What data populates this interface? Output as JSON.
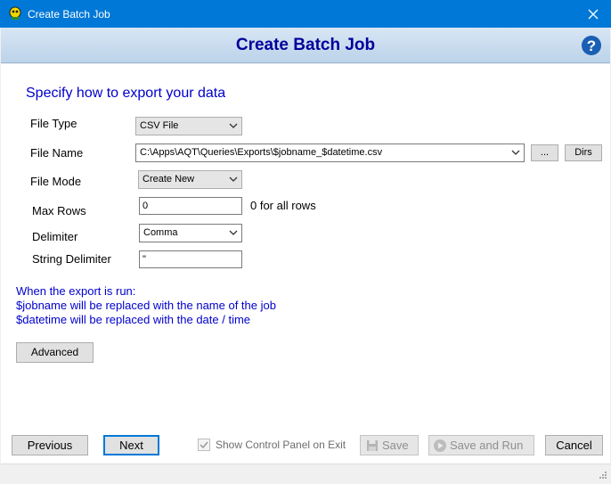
{
  "window": {
    "title": "Create Batch Job",
    "close_glyph": "✕"
  },
  "header": {
    "title": "Create Batch Job",
    "help_glyph": "?"
  },
  "section": {
    "heading": "Specify how to export your data"
  },
  "form": {
    "file_type": {
      "label": "File Type",
      "value": "CSV File"
    },
    "file_name": {
      "label": "File Name",
      "value": "C:\\Apps\\AQT\\Queries\\Exports\\$jobname_$datetime.csv",
      "browse_label": "...",
      "dirs_label": "Dirs"
    },
    "file_mode": {
      "label": "File Mode",
      "value": "Create New"
    },
    "max_rows": {
      "label": "Max Rows",
      "value": "0",
      "hint": "0 for all rows"
    },
    "delimiter": {
      "label": "Delimiter",
      "value": "Comma"
    },
    "string_delimiter": {
      "label": "String Delimiter",
      "value": "\""
    }
  },
  "info": {
    "line1": "When the export is run:",
    "line2": "$jobname will be replaced with the name of the job",
    "line3": "$datetime will be replaced with the date / time"
  },
  "buttons": {
    "advanced": "Advanced",
    "previous": "Previous",
    "next": "Next",
    "save": "Save",
    "save_and_run": "Save and Run",
    "cancel": "Cancel"
  },
  "checkbox": {
    "label": "Show Control Panel on Exit",
    "checked": true
  },
  "colors": {
    "titlebar": "#0078d7",
    "heading": "#0000cc",
    "header_title": "#00009b",
    "help": "#1a5fb4"
  }
}
